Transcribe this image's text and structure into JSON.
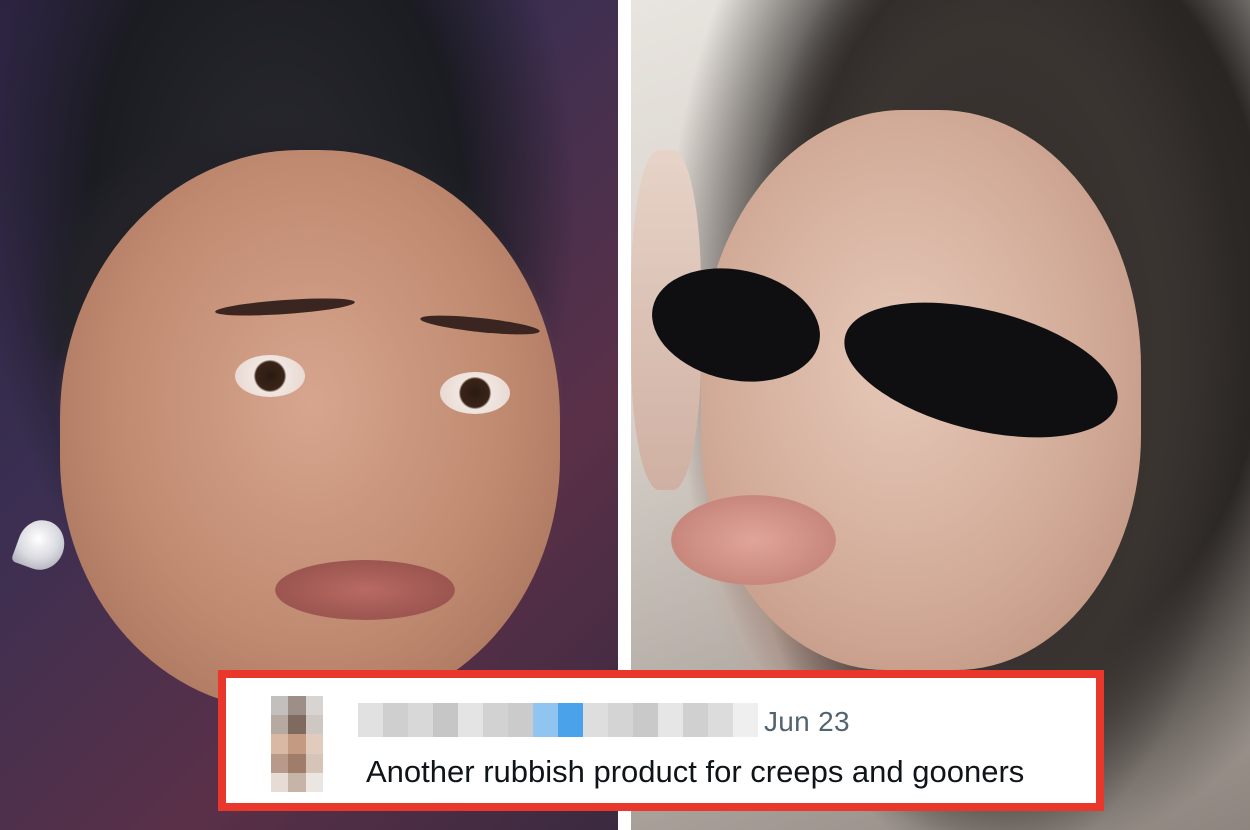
{
  "tweet": {
    "date": "Jun 23",
    "text": "Another rubbish product for creeps and gooners",
    "border_color": "#e9372b",
    "avatar_pixels": [
      "#c2bfbd",
      "#9d8f88",
      "#d8d4d1",
      "#b5a9a2",
      "#7e6a5f",
      "#cfc7c1",
      "#d9b8a4",
      "#c49a83",
      "#e1cbbd",
      "#b89a8a",
      "#a07d6b",
      "#d7c4b8",
      "#e6dcd5",
      "#c7b4a8",
      "#ece6e2"
    ],
    "name_blur_pixels": [
      "#e1e1e1",
      "#cfcfcf",
      "#d8d8d8",
      "#c6c6c6",
      "#e4e4e4",
      "#d2d2d2",
      "#cbcbcb",
      "#8fc5ef",
      "#4aa3ea",
      "#dedede",
      "#d4d4d4",
      "#c9c9c9",
      "#e6e6e6",
      "#d0d0d0",
      "#dcdcdc",
      "#efefef"
    ]
  }
}
